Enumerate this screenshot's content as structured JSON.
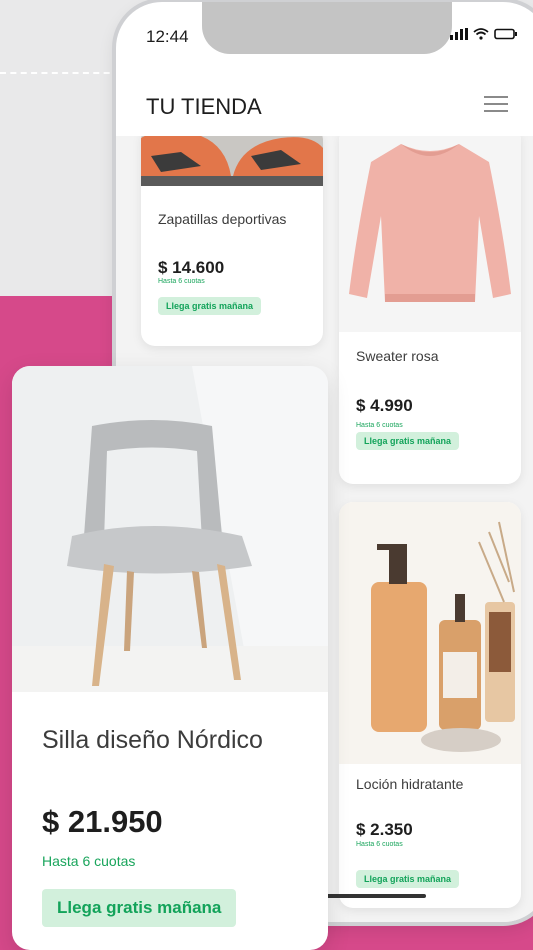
{
  "status_bar": {
    "time": "12:44"
  },
  "header": {
    "store_name": "TU TIENDA"
  },
  "products": [
    {
      "name": "Zapatillas deportivas",
      "price": "$ 14.600",
      "installments": "Hasta 6 cuotas",
      "shipping": "Llega gratis mañana"
    },
    {
      "name": "Sweater rosa",
      "price": "$ 4.990",
      "installments": "Hasta 6 cuotas",
      "shipping": "Llega gratis mañana"
    },
    {
      "name": "Loción hidratante",
      "price": "$ 2.350",
      "installments": "Hasta 6 cuotas",
      "shipping": "Llega gratis mañana"
    }
  ],
  "featured": {
    "name": "Silla diseño Nórdico",
    "price": "$ 21.950",
    "installments": "Hasta 6 cuotas",
    "shipping": "Llega gratis mañana"
  },
  "colors": {
    "brand_pink": "#d6498a",
    "shipping_green": "#13a35a",
    "shipping_bg": "#d2f0dc"
  },
  "icons": {
    "menu": "hamburger-menu-icon",
    "signal": "signal-icon",
    "wifi": "wifi-icon",
    "battery": "battery-icon"
  }
}
